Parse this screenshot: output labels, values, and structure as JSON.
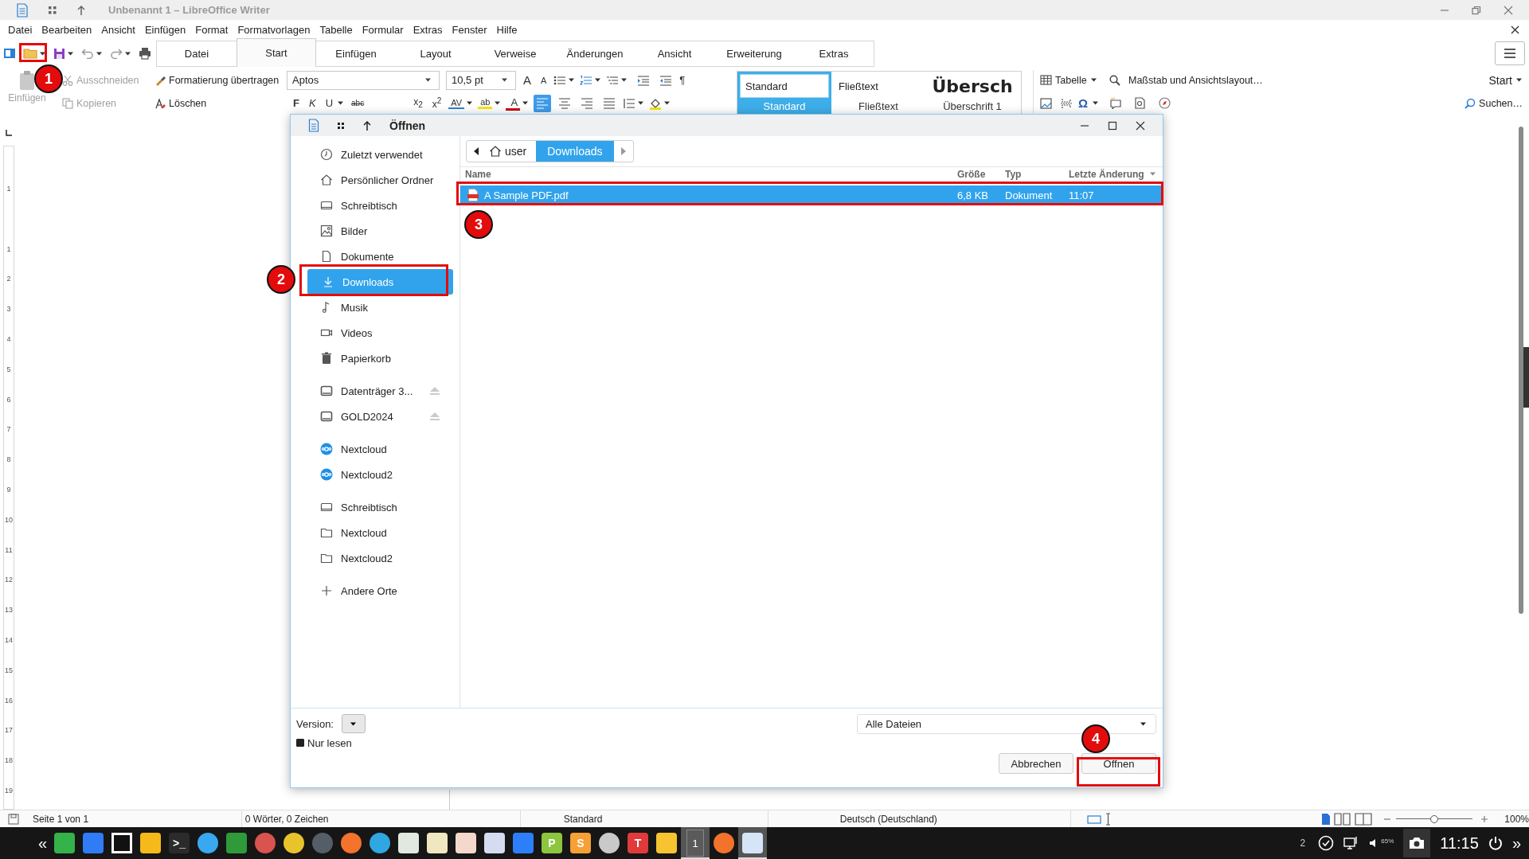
{
  "window": {
    "title": "Unbenannt 1 – LibreOffice Writer"
  },
  "menu": [
    "Datei",
    "Bearbeiten",
    "Ansicht",
    "Einfügen",
    "Format",
    "Formatvorlagen",
    "Tabelle",
    "Formular",
    "Extras",
    "Fenster",
    "Hilfe"
  ],
  "ribbon_tabs": [
    {
      "label": "Datei",
      "selected": false
    },
    {
      "label": "Start",
      "selected": true
    },
    {
      "label": "Einfügen",
      "selected": false
    },
    {
      "label": "Layout",
      "selected": false
    },
    {
      "label": "Verweise",
      "selected": false
    },
    {
      "label": "Änderungen",
      "selected": false
    },
    {
      "label": "Ansicht",
      "selected": false
    },
    {
      "label": "Erweiterung",
      "selected": false
    },
    {
      "label": "Extras",
      "selected": false
    }
  ],
  "toolbar": {
    "paste": {
      "label": "Einfügen",
      "disabled": true
    },
    "cut": {
      "label": "Ausschneiden",
      "disabled": true
    },
    "copy": {
      "label": "Kopieren",
      "disabled": true
    },
    "clone": "Formatierung übertragen",
    "clear": "Löschen",
    "font_name": "Aptos",
    "font_size": "10,5 pt",
    "grow_font": "A",
    "shrink_font": "A",
    "marks": "¶",
    "bold": "F",
    "italic": "K",
    "underline": "U",
    "strike": "abc",
    "subscript": "x$_{2}$",
    "superscript": "x$^{2}$",
    "spacing": "AV",
    "highlight": "ab",
    "font_color": "A",
    "alignment": [
      {
        "selected": true
      },
      {
        "selected": false
      },
      {
        "selected": false
      },
      {
        "selected": false
      }
    ],
    "styles": [
      {
        "preview": "Standard",
        "caption": "Standard",
        "selected": true
      },
      {
        "preview": "Fließtext",
        "caption": "Fließtext",
        "selected": false
      },
      {
        "preview": "Übersch",
        "caption": "Überschrift 1",
        "selected": false
      }
    ],
    "table": "Tabelle",
    "special_char": "Ω",
    "zoom_layout": "Maßstab und Ansichtslayout…",
    "start_menu": "Start",
    "search": "Suchen…"
  },
  "ruler_labels": [
    "1",
    "1",
    "2",
    "3",
    "4",
    "5",
    "6",
    "7",
    "8",
    "9",
    "10",
    "11",
    "12",
    "13",
    "14",
    "15",
    "16",
    "17",
    "18",
    "19"
  ],
  "dialog": {
    "title": "Öffnen",
    "places": [
      {
        "items": [
          {
            "label": "Zuletzt verwendet",
            "kind": "recent",
            "selected": false
          },
          {
            "label": "Persönlicher Ordner",
            "kind": "home",
            "selected": false
          },
          {
            "label": "Schreibtisch",
            "kind": "desktop",
            "selected": false
          },
          {
            "label": "Bilder",
            "kind": "pictures",
            "selected": false
          },
          {
            "label": "Dokumente",
            "kind": "documents",
            "selected": false
          },
          {
            "label": "Downloads",
            "kind": "downloads",
            "selected": true
          },
          {
            "label": "Musik",
            "kind": "music",
            "selected": false
          },
          {
            "label": "Videos",
            "kind": "videos",
            "selected": false
          },
          {
            "label": "Papierkorb",
            "kind": "trash",
            "selected": false
          }
        ]
      },
      {
        "items": [
          {
            "label": "Datenträger 3...",
            "kind": "drive",
            "selected": false,
            "ejectable": true
          },
          {
            "label": "GOLD2024",
            "kind": "drive",
            "selected": false,
            "ejectable": true
          }
        ]
      },
      {
        "items": [
          {
            "label": "Nextcloud",
            "kind": "cloud",
            "selected": false
          },
          {
            "label": "Nextcloud2",
            "kind": "cloud",
            "selected": false
          }
        ]
      },
      {
        "items": [
          {
            "label": "Schreibtisch",
            "kind": "desktop",
            "selected": false
          },
          {
            "label": "Nextcloud",
            "kind": "folder",
            "selected": false
          },
          {
            "label": "Nextcloud2",
            "kind": "folder",
            "selected": false
          }
        ]
      },
      {
        "items": [
          {
            "label": "Andere Orte",
            "kind": "other",
            "selected": false
          }
        ]
      }
    ],
    "path": [
      {
        "label": "user",
        "kind": "home",
        "selected": false
      },
      {
        "label": "Downloads",
        "kind": "folder",
        "selected": true
      }
    ],
    "columns": [
      {
        "label": "Name",
        "sorted": false
      },
      {
        "label": "Größe",
        "sorted": false
      },
      {
        "label": "Typ",
        "sorted": false
      },
      {
        "label": "Letzte Änderung",
        "sorted": true
      }
    ],
    "files": [
      {
        "name": "A Sample PDF.pdf",
        "size": "6,8 KB",
        "type": "Dokument",
        "modified": "11:07",
        "kind": "pdf",
        "selected": true
      }
    ],
    "version_label": "Version:",
    "read_only": {
      "label": "Nur lesen",
      "checked": true
    },
    "filter": "Alle Dateien",
    "buttons": [
      "Abbrechen",
      "Öffnen"
    ]
  },
  "annotations": [
    "1",
    "2",
    "3",
    "4"
  ],
  "status_bar": {
    "page": "Seite 1 von 1",
    "words": "0 Wörter, 0 Zeichen",
    "style": "Standard",
    "language": "Deutsch (Deutschland)",
    "zoom_slider": {
      "level": 0.5
    },
    "zoom": "100%"
  },
  "taskbar": {
    "left": "«",
    "apps": [
      {
        "kind": "tile",
        "color": "#35b24a",
        "active": false
      },
      {
        "kind": "tile",
        "color": "#2f7cf6",
        "active": false
      },
      {
        "kind": "outline",
        "color": "#ffffff",
        "active": false
      },
      {
        "kind": "tile",
        "color": "#f6b91a",
        "active": false
      },
      {
        "kind": "tile",
        "color": "#2b2b2b",
        "glyph": ">_",
        "active": false
      },
      {
        "kind": "circle",
        "color": "#3aa8f0",
        "active": false
      },
      {
        "kind": "tile",
        "color": "#2e9a3a",
        "active": false
      },
      {
        "kind": "circle",
        "color": "#d9534f",
        "active": false
      },
      {
        "kind": "circle",
        "color": "#e9c32b",
        "active": false
      },
      {
        "kind": "circle",
        "color": "#555d66",
        "active": false
      },
      {
        "kind": "circle",
        "color": "#f3722c",
        "active": false
      },
      {
        "kind": "circle",
        "color": "#2fa7e0",
        "active": false
      },
      {
        "kind": "tile",
        "color": "#dfe9df",
        "active": false
      },
      {
        "kind": "tile",
        "color": "#f0e6c0",
        "active": false
      },
      {
        "kind": "tile",
        "color": "#f4d8cc",
        "active": false
      },
      {
        "kind": "tile",
        "color": "#d6dcf0",
        "active": false
      },
      {
        "kind": "tile",
        "color": "#2d7ff9",
        "active": false
      },
      {
        "kind": "tile",
        "color": "#8cc63f",
        "glyph": "P",
        "active": false
      },
      {
        "kind": "tile",
        "color": "#f7a035",
        "glyph": "S",
        "active": false
      },
      {
        "kind": "circle",
        "color": "#c9c9c9",
        "active": false
      },
      {
        "kind": "tile",
        "color": "#e03a3a",
        "glyph": "T",
        "active": false
      },
      {
        "kind": "tile",
        "color": "#f6c431",
        "active": false
      },
      {
        "kind": "workspace",
        "glyph": "1",
        "active": true
      },
      {
        "kind": "circle",
        "color": "#f3722c",
        "active": false
      },
      {
        "kind": "tile",
        "color": "#d6e4f7",
        "active": true
      }
    ],
    "workspaces": "2",
    "volume": "65%",
    "clock": "11:15",
    "more": "»"
  }
}
